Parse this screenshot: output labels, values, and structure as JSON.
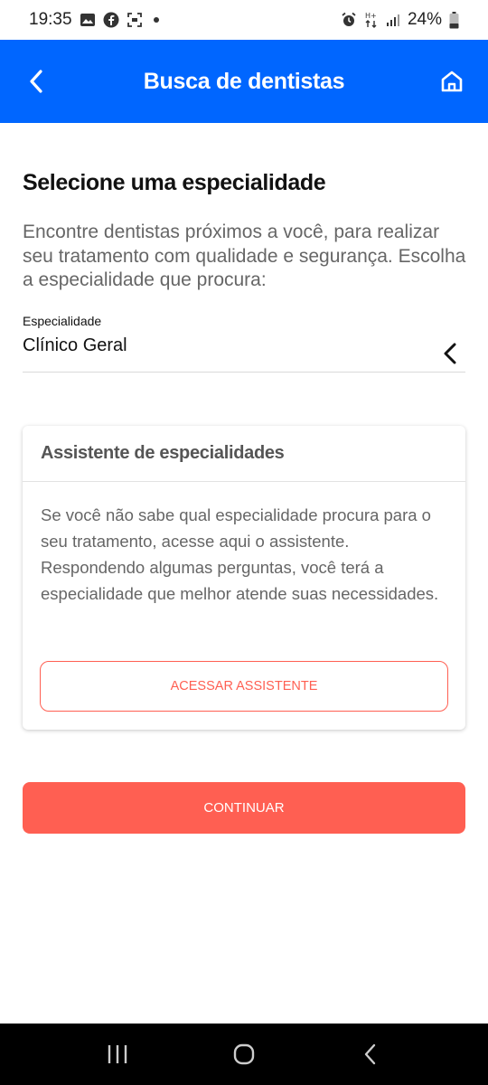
{
  "status_bar": {
    "time": "19:35",
    "battery": "24%",
    "left_icons": [
      "image-icon",
      "facebook-icon",
      "screenshot-icon",
      "dot-icon"
    ],
    "right_icons": [
      "alarm-icon",
      "data-icon",
      "signal-icon",
      "battery-icon"
    ]
  },
  "app_bar": {
    "title": "Busca de dentistas",
    "background": "#0066ff",
    "back_icon": "chevron-left-icon",
    "home_icon": "home-icon"
  },
  "main": {
    "section_title": "Selecione uma especialidade",
    "intro": "Encontre dentistas próximos a você, para realizar seu tratamento com qualidade e segurança. Escolha a especialidade que procura:",
    "field": {
      "label": "Especialidade",
      "value": "Clínico Geral",
      "icon": "chevron-left-icon"
    },
    "assistant_card": {
      "title": "Assistente de especialidades",
      "body": "Se você não sabe qual especialidade procura para o seu tratamento, acesse aqui o assistente. Respondendo algumas perguntas, você terá a especialidade que melhor atende suas necessidades.",
      "button_label": "ACESSAR ASSISTENTE"
    },
    "continue_label": "CONTINUAR",
    "accent": "#ff5f52"
  },
  "nav_bar": {
    "buttons": [
      "recents-icon",
      "home-circle-icon",
      "back-icon"
    ]
  }
}
